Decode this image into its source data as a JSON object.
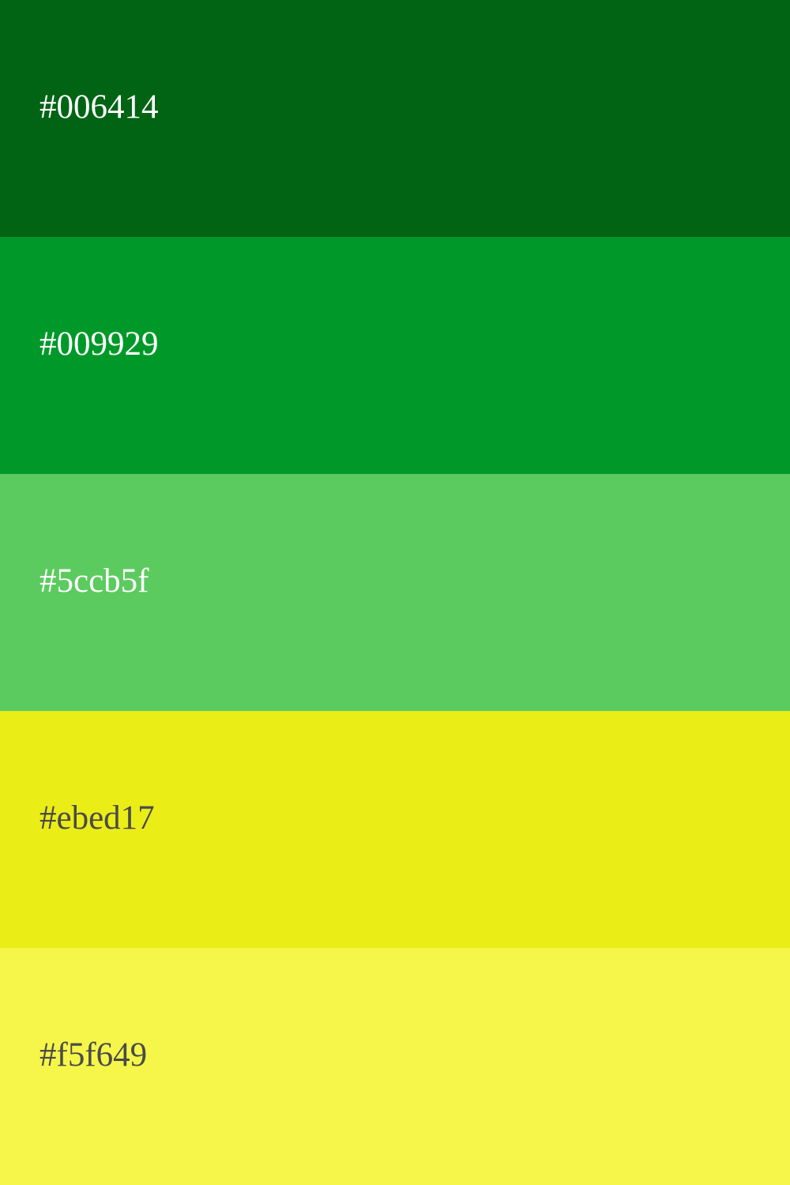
{
  "swatches": [
    {
      "label": "#006414",
      "background": "#006414",
      "text_color": "#ffffff"
    },
    {
      "label": "#009929",
      "background": "#009929",
      "text_color": "#ffffff"
    },
    {
      "label": "#5ccb5f",
      "background": "#5ccb5f",
      "text_color": "#ffffff"
    },
    {
      "label": "#ebed17",
      "background": "#ebed17",
      "text_color": "#4a4a4a"
    },
    {
      "label": "#f5f649",
      "background": "#f5f649",
      "text_color": "#4a4a4a"
    }
  ]
}
